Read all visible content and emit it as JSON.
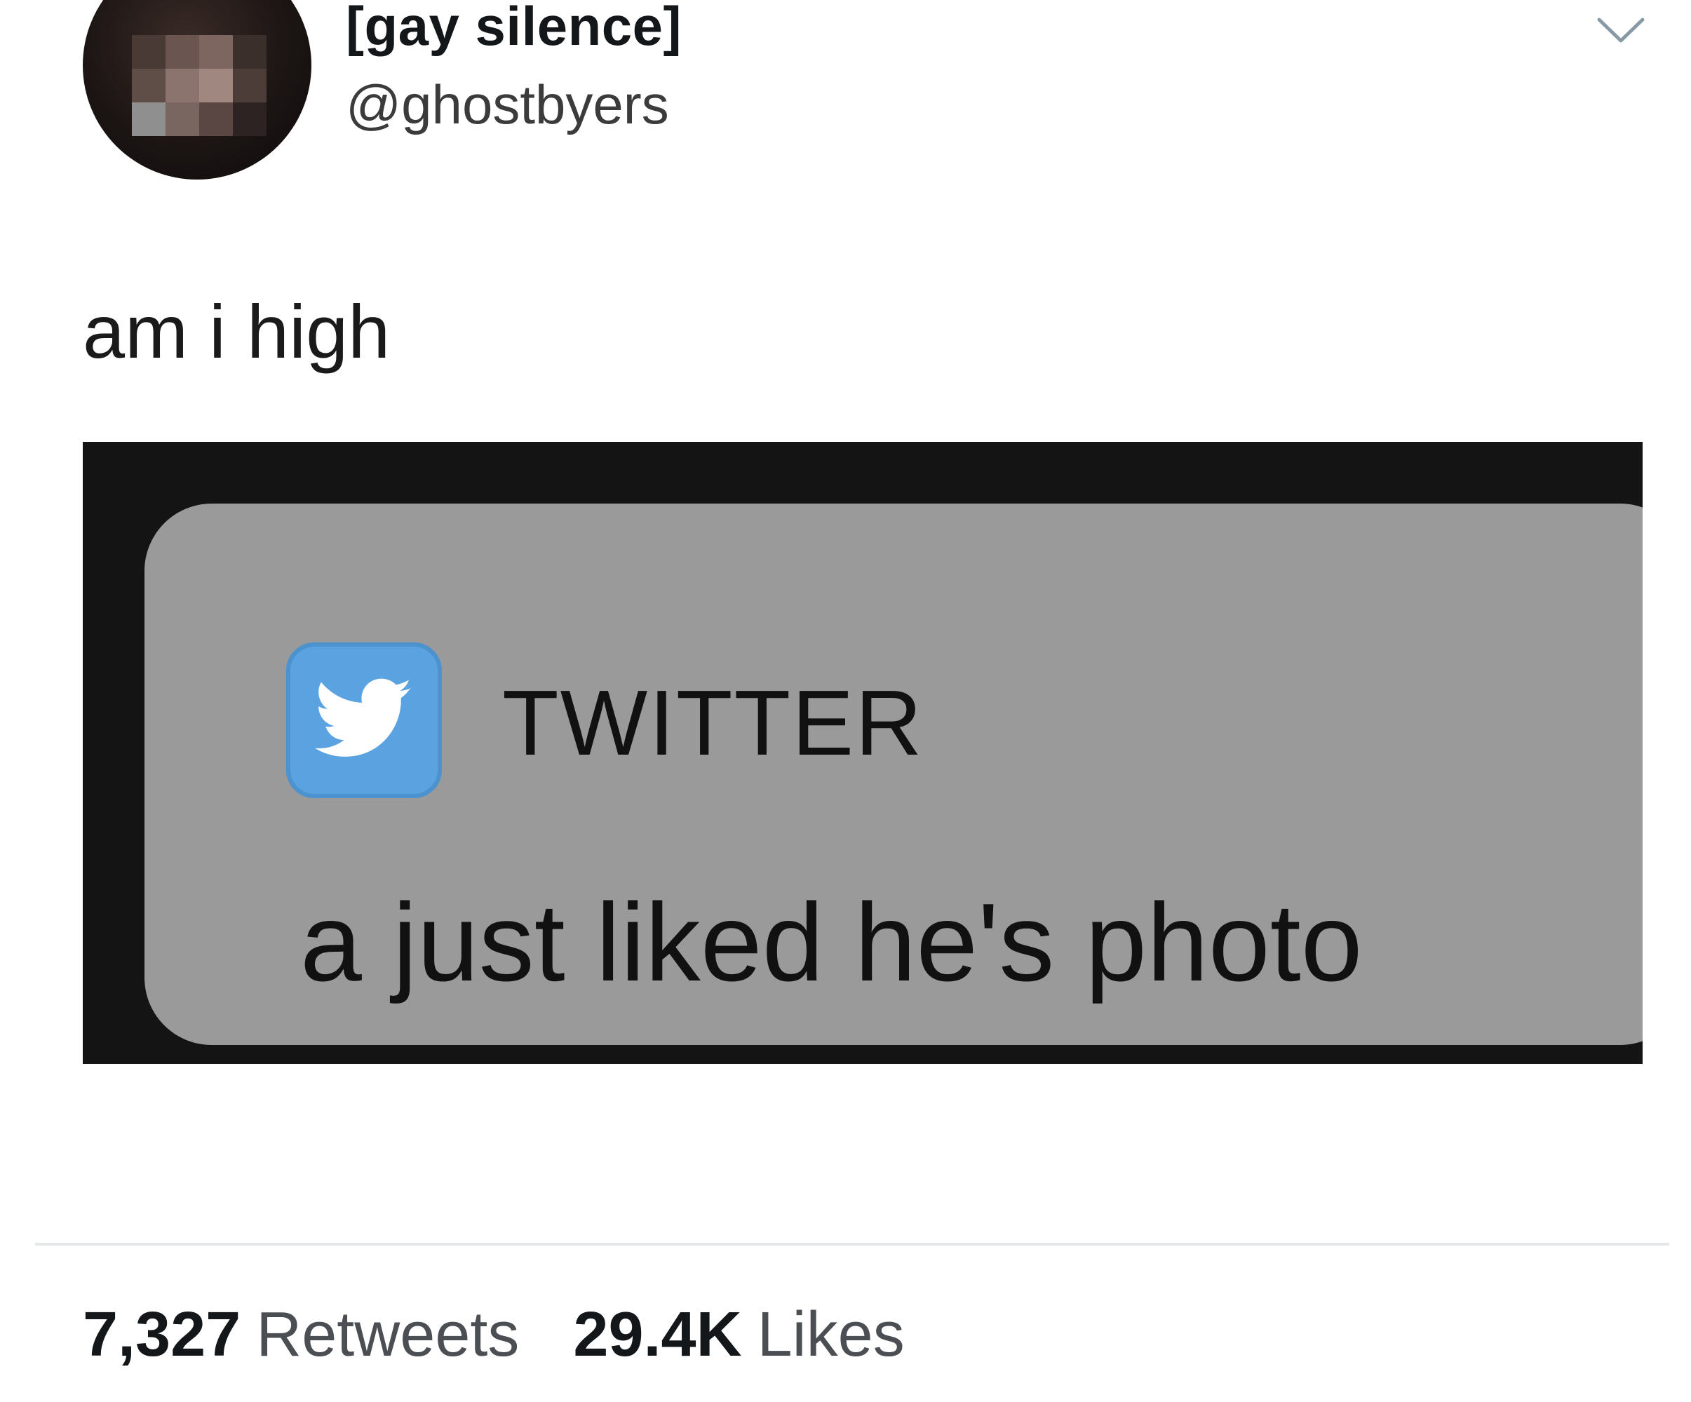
{
  "tweet": {
    "display_name": "[gay silence]",
    "handle": "@ghostbyers",
    "text": "am i high",
    "menu_icon": "chevron-down-icon"
  },
  "media": {
    "notification": {
      "app_icon": "twitter-bird-icon",
      "app_name": "TWITTER",
      "message": "a just liked he's photo"
    },
    "colors": {
      "frame": "#141414",
      "banner": "#9a9a9a",
      "app_icon_bg": "#5aa3e0"
    }
  },
  "stats": {
    "retweets_count": "7,327",
    "retweets_label": "Retweets",
    "likes_count": "29.4K",
    "likes_label": "Likes"
  }
}
